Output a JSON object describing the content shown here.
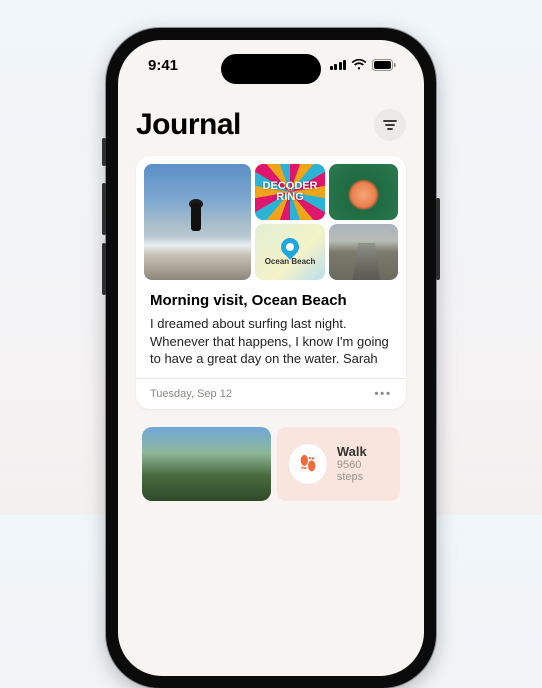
{
  "status": {
    "time": "9:41"
  },
  "header": {
    "title": "Journal"
  },
  "entry1": {
    "title": "Morning visit, Ocean Beach",
    "body": "I dreamed about surfing last night. Whenever that happens, I know I'm going to have a great day on the water. Sarah",
    "date": "Tuesday, Sep 12",
    "podcast_label": "DECODER RING",
    "map_label": "Ocean Beach"
  },
  "entry2": {
    "activity_name": "Walk",
    "activity_detail": "9560 steps"
  }
}
